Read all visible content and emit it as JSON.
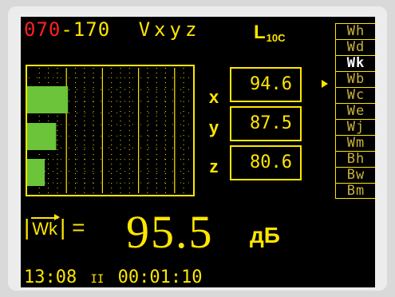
{
  "header": {
    "range_low": "070",
    "range_sep_high": "-170",
    "vector": "Vxyz",
    "level_mode": "L",
    "level_sub": "10C"
  },
  "chart_data": {
    "type": "bar",
    "orientation": "horizontal",
    "categories": [
      "x",
      "y",
      "z"
    ],
    "values": [
      94.6,
      87.5,
      80.6
    ],
    "xlim": [
      70,
      170
    ],
    "bar_color": "#6bc43a"
  },
  "readouts": [
    {
      "axis": "x",
      "value": "94.6"
    },
    {
      "axis": "y",
      "value": "87.5"
    },
    {
      "axis": "z",
      "value": "80.6"
    }
  ],
  "menu": {
    "selected": "Wk",
    "items": [
      "Wh",
      "Wd",
      "Wk",
      "Wb",
      "Wc",
      "We",
      "Wj",
      "Wm",
      "Bh",
      "Bw",
      "Bm"
    ]
  },
  "result": {
    "label_bar": "|",
    "label_vec": "Wk",
    "label_tail": "| =",
    "value": "95.5",
    "unit": "дБ"
  },
  "footer": {
    "clock": "13:08",
    "pause_symbol": "II",
    "elapsed": "00:01:10"
  },
  "colors": {
    "accent": "#ffe600",
    "range_low": "#ff2020",
    "bar": "#6bc43a",
    "menu_text": "#c9b13a",
    "menu_selected": "#ffffff",
    "screen_bg": "#000000"
  }
}
